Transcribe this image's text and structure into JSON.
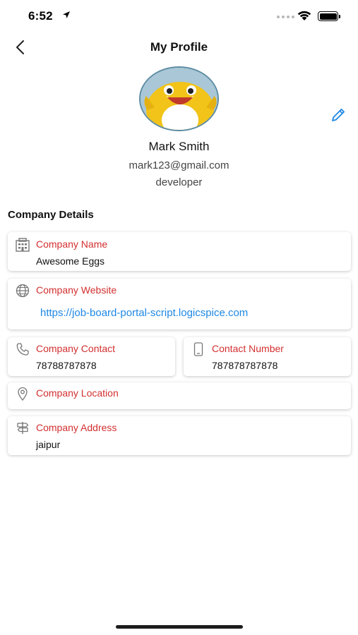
{
  "status_bar": {
    "time": "6:52"
  },
  "header": {
    "title": "My Profile"
  },
  "profile": {
    "name": "Mark Smith",
    "email": "mark123@gmail.com",
    "role": "developer"
  },
  "section": {
    "title": "Company Details"
  },
  "company": {
    "name": {
      "label": "Company Name",
      "value": "Awesome Eggs",
      "icon": "building-icon"
    },
    "website": {
      "label": "Company Website",
      "value": "https://job-board-portal-script.logicspice.com",
      "icon": "globe-icon"
    },
    "contact": {
      "label": "Company Contact",
      "value": "78788787878",
      "icon": "phone-icon"
    },
    "contact_number": {
      "label": "Contact Number",
      "value": "787878787878",
      "icon": "mobile-icon"
    },
    "location": {
      "label": "Company Location",
      "value": "",
      "icon": "location-pin-icon"
    },
    "address": {
      "label": "Company Address",
      "value": "jaipur",
      "icon": "signpost-icon"
    }
  },
  "colors": {
    "label_red": "#d32f2f",
    "link_blue": "#1e88e5",
    "edit_blue": "#1e88e5"
  }
}
